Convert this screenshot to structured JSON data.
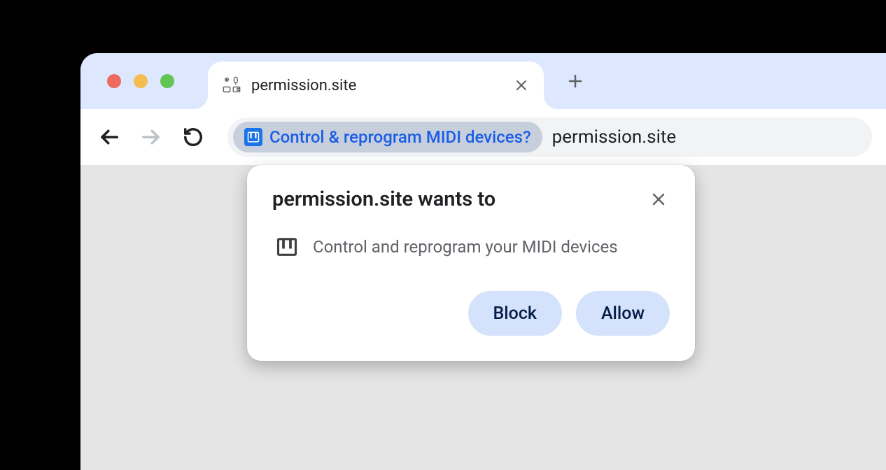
{
  "tab": {
    "title": "permission.site"
  },
  "address": {
    "permission_chip": "Control & reprogram MIDI devices?",
    "url": "permission.site"
  },
  "dialog": {
    "title": "permission.site wants to",
    "body": "Control and reprogram your MIDI devices",
    "block_label": "Block",
    "allow_label": "Allow"
  }
}
